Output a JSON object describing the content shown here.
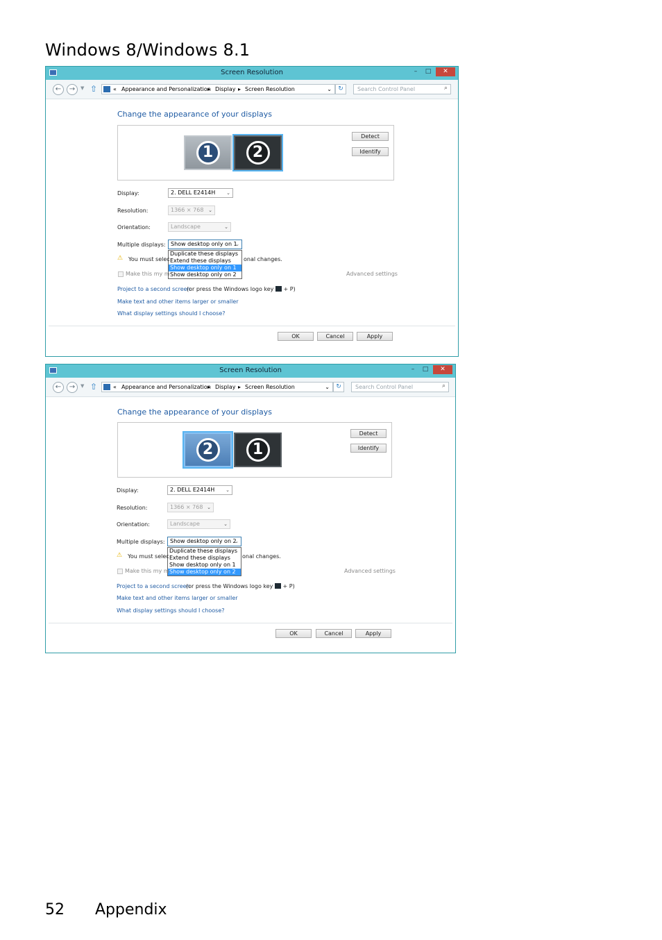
{
  "page": {
    "heading": "Windows 8/Windows 8.1",
    "page_number": "52",
    "section": "Appendix"
  },
  "windows": [
    {
      "title": "Screen Resolution",
      "controls": {
        "minimize": "–",
        "maximize": "□",
        "close": "✕"
      },
      "breadcrumb": {
        "prefix": "«",
        "items": [
          "Appearance and Personalization",
          "Display",
          "Screen Resolution"
        ]
      },
      "search_placeholder": "Search Control Panel",
      "heading": "Change the appearance of your displays",
      "monitors": [
        "1",
        "2"
      ],
      "detect_label": "Detect",
      "identify_label": "Identify",
      "display_label": "Display:",
      "display_value": "2. DELL E2414H",
      "resolution_label": "Resolution:",
      "resolution_value": "1366 × 768",
      "orientation_label": "Orientation:",
      "orientation_value": "Landscape",
      "multiple_label": "Multiple displays:",
      "multiple_value": "Show desktop only on 1",
      "dropdown_options": [
        "Duplicate these displays",
        "Extend these displays",
        "Show desktop only on 1",
        "Show desktop only on 2"
      ],
      "dropdown_selected_index": 2,
      "warning_left": "You must selec",
      "warning_right": "onal changes.",
      "main_display_text": "Make this my m",
      "advanced_settings": "Advanced settings",
      "project_link": "Project to a second screen",
      "project_hint_pre": "(or press the Windows logo key",
      "project_hint_post": "+ P)",
      "text_size_link": "Make text and other items larger or smaller",
      "what_settings_link": "What display settings should I choose?",
      "ok_label": "OK",
      "cancel_label": "Cancel",
      "apply_label": "Apply"
    },
    {
      "title": "Screen Resolution",
      "controls": {
        "minimize": "–",
        "maximize": "□",
        "close": "✕"
      },
      "breadcrumb": {
        "prefix": "«",
        "items": [
          "Appearance and Personalization",
          "Display",
          "Screen Resolution"
        ]
      },
      "search_placeholder": "Search Control Panel",
      "heading": "Change the appearance of your displays",
      "monitors": [
        "2",
        "1"
      ],
      "detect_label": "Detect",
      "identify_label": "Identify",
      "display_label": "Display:",
      "display_value": "2. DELL E2414H",
      "resolution_label": "Resolution:",
      "resolution_value": "1366 × 768",
      "orientation_label": "Orientation:",
      "orientation_value": "Landscape",
      "multiple_label": "Multiple displays:",
      "multiple_value": "Show desktop only on 2",
      "dropdown_options": [
        "Duplicate these displays",
        "Extend these displays",
        "Show desktop only on 1",
        "Show desktop only on 2"
      ],
      "dropdown_selected_index": 3,
      "warning_left": "You must selec",
      "warning_right": "onal changes.",
      "main_display_text": "Make this my m",
      "advanced_settings": "Advanced settings",
      "project_link": "Project to a second screen",
      "project_hint_pre": "(or press the Windows logo key",
      "project_hint_post": "+ P)",
      "text_size_link": "Make text and other items larger or smaller",
      "what_settings_link": "What display settings should I choose?",
      "ok_label": "OK",
      "cancel_label": "Cancel",
      "apply_label": "Apply"
    }
  ]
}
